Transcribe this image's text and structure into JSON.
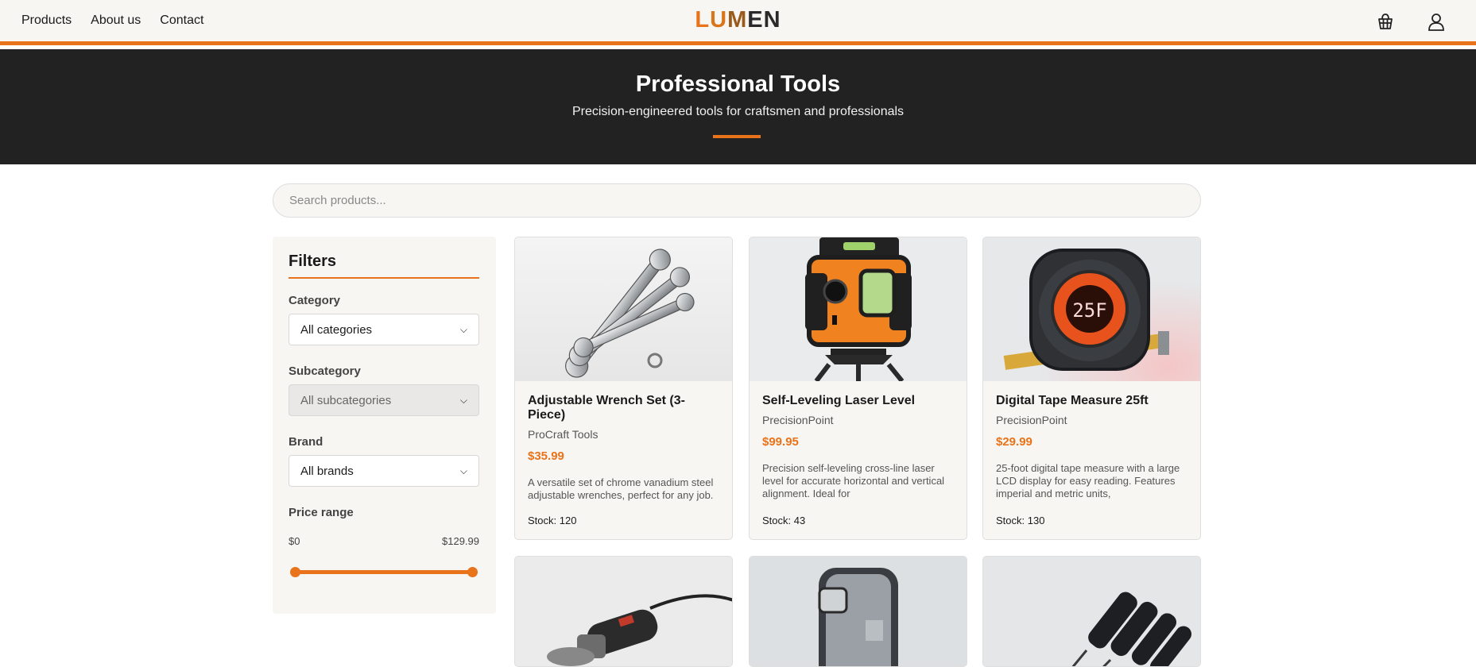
{
  "nav": {
    "links": [
      "Products",
      "About us",
      "Contact"
    ],
    "logo": [
      "L",
      "U",
      "M",
      "EN"
    ],
    "icons": [
      "basket-icon",
      "user-icon"
    ]
  },
  "hero": {
    "title": "Professional Tools",
    "subtitle": "Precision-engineered tools for craftsmen and professionals"
  },
  "search": {
    "placeholder": "Search products..."
  },
  "filters": {
    "title": "Filters",
    "category": {
      "label": "Category",
      "value": "All categories"
    },
    "subcategory": {
      "label": "Subcategory",
      "value": "All subcategories"
    },
    "brand": {
      "label": "Brand",
      "value": "All brands"
    },
    "price": {
      "label": "Price range",
      "min": "$0",
      "max": "$129.99"
    }
  },
  "products": [
    {
      "title": "Adjustable Wrench Set (3-Piece)",
      "brand": "ProCraft Tools",
      "price": "$35.99",
      "desc": "A versatile set of chrome vanadium steel adjustable wrenches, perfect for any job.",
      "stock": "Stock: 120"
    },
    {
      "title": "Self-Leveling Laser Level",
      "brand": "PrecisionPoint",
      "price": "$99.95",
      "desc": "Precision self-leveling cross-line laser level for accurate horizontal and vertical alignment. Ideal for",
      "stock": "Stock: 43"
    },
    {
      "title": "Digital Tape Measure 25ft",
      "brand": "PrecisionPoint",
      "price": "$29.99",
      "desc": "25-foot digital tape measure with a large LCD display for easy reading. Features imperial and metric units,",
      "stock": "Stock: 130",
      "display": "25F"
    }
  ],
  "colors": {
    "accent": "#e8731a",
    "dark": "#222222",
    "panel": "#f8f6f3"
  }
}
